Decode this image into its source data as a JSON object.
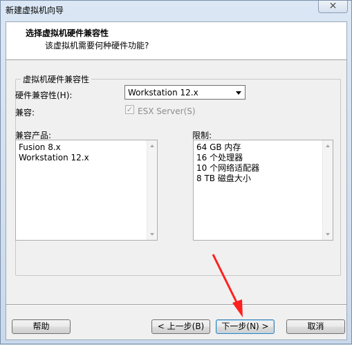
{
  "window": {
    "title": "新建虚拟机向导",
    "close": "✕"
  },
  "header": {
    "title": "选择虚拟机硬件兼容性",
    "subtitle": "该虚拟机需要何种硬件功能?"
  },
  "group": {
    "legend": "虚拟机硬件兼容性",
    "hw_label": "硬件兼容性(H):",
    "hw_value": "Workstation 12.x",
    "compat_label": "兼容:",
    "compat_checkbox": "ESX Server(S)",
    "compat_checked": true,
    "products_label": "兼容产品:",
    "products": [
      "Fusion 8.x",
      "Workstation 12.x"
    ],
    "limits_label": "限制:",
    "limits": [
      "64 GB 内存",
      "16 个处理器",
      "10 个网络适配器",
      "8 TB 磁盘大小"
    ]
  },
  "buttons": {
    "help": "帮助",
    "back": "< 上一步(B)",
    "next": "下一步(N) >",
    "cancel": "取消"
  },
  "icons": {
    "dropdown": "chevron-down-icon",
    "check": "checkmark-icon"
  },
  "colors": {
    "annotation_arrow": "#ff2020"
  }
}
